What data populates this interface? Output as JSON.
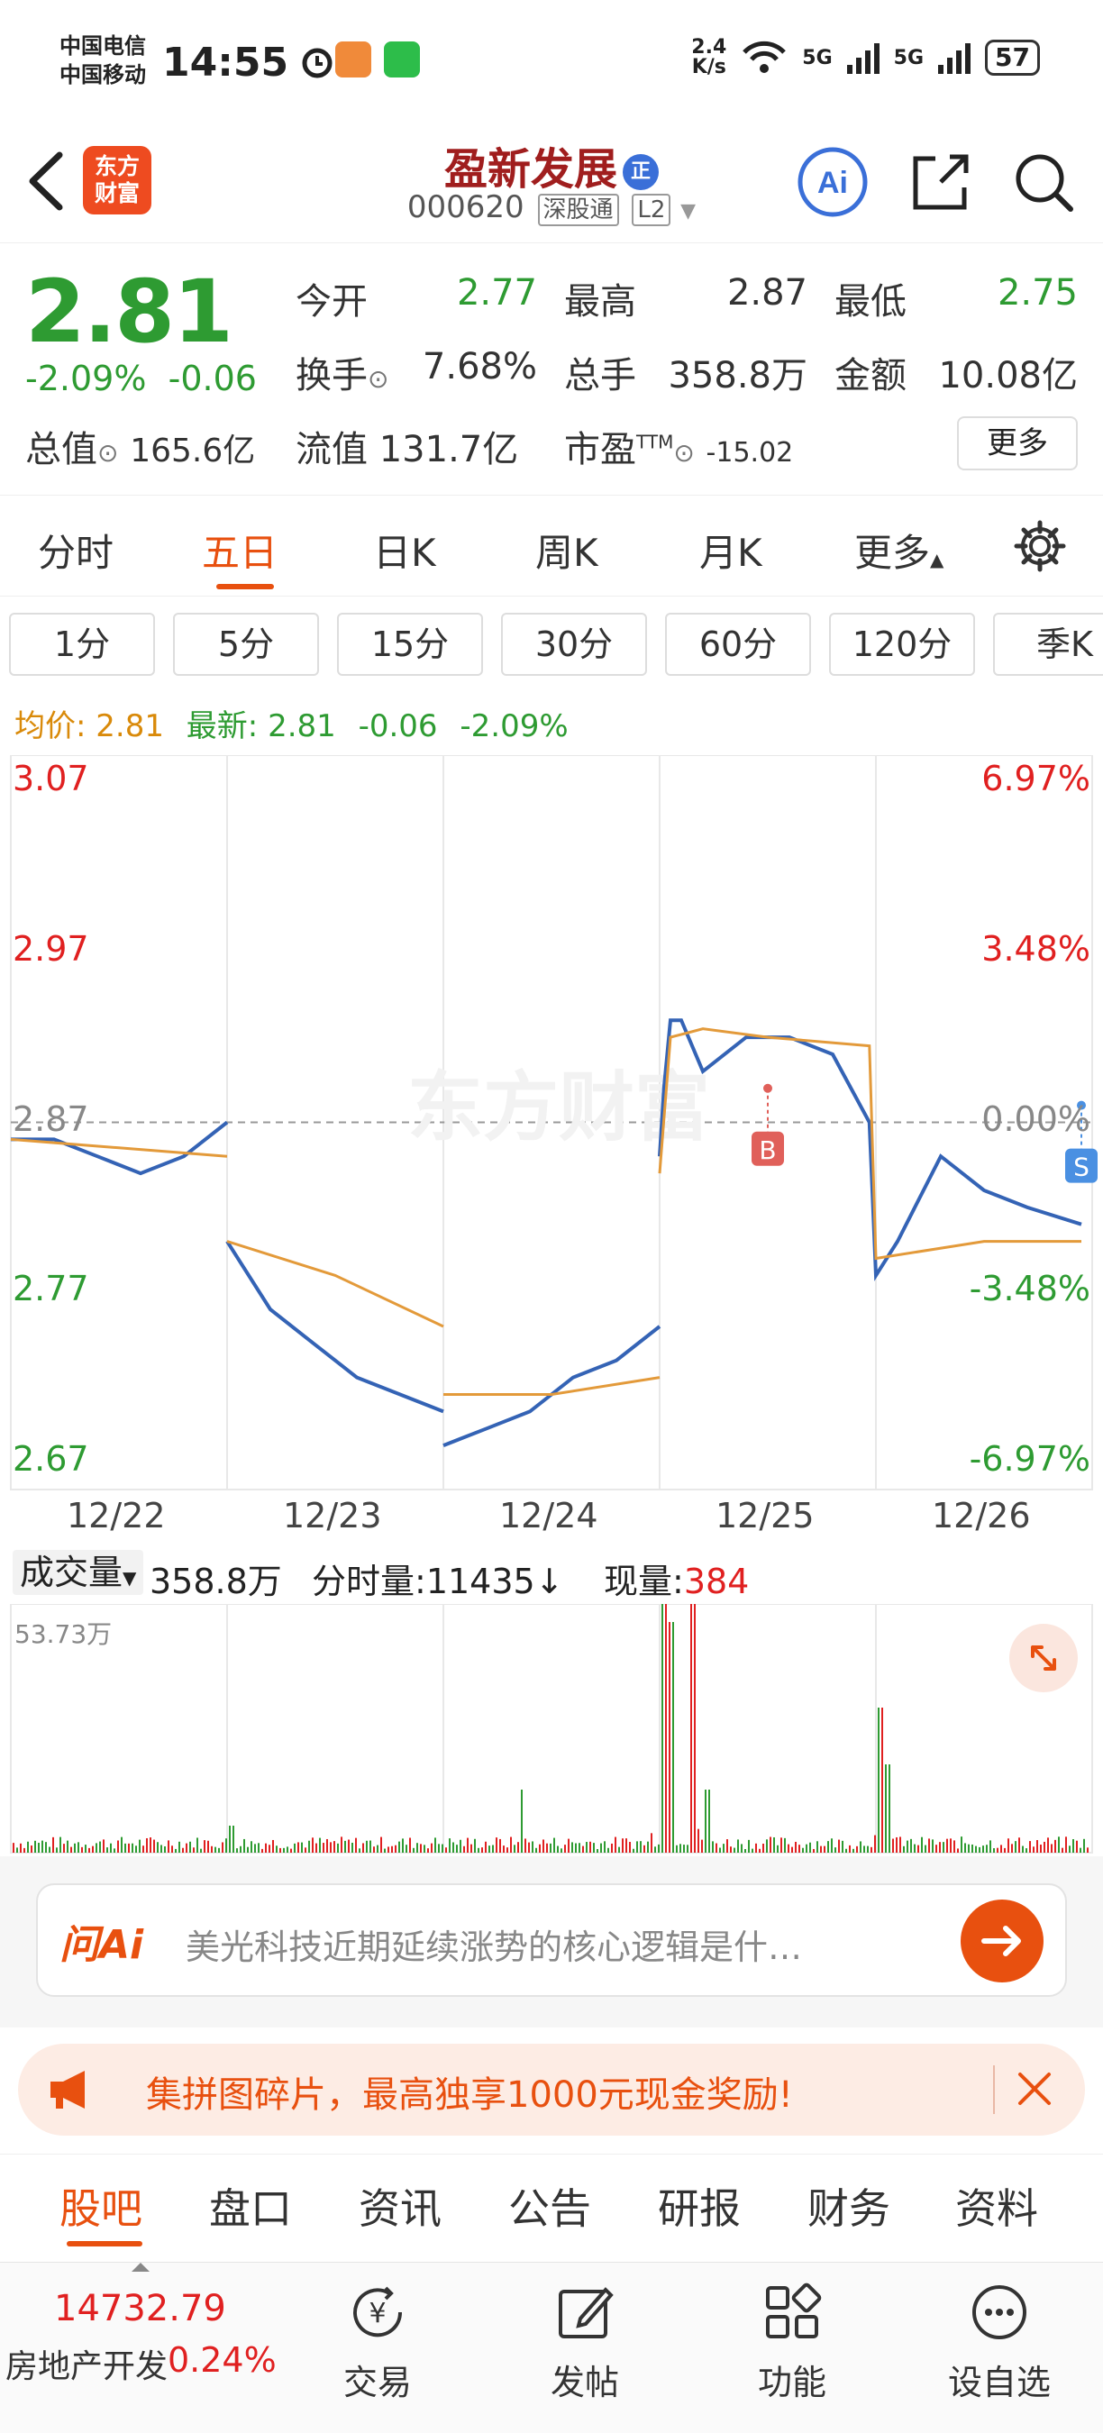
{
  "status_bar": {
    "carrier1": "中国电信",
    "carrier2": "中国移动",
    "time": "14:55",
    "net_speed_top": "2.4",
    "net_speed_bottom": "K/s",
    "signal1": "5G",
    "signal2": "5G",
    "battery": "57"
  },
  "header": {
    "logo_line1": "东方",
    "logo_line2": "财富",
    "stock_name": "盈新发展",
    "badge": "正",
    "stock_code": "000620",
    "tag1": "深股通",
    "tag2": "L2",
    "ai_label": "Ai"
  },
  "quote": {
    "price": "2.81",
    "change_pct": "-2.09%",
    "change": "-0.06",
    "open_label": "今开",
    "open": "2.77",
    "high_label": "最高",
    "high": "2.87",
    "low_label": "最低",
    "low": "2.75",
    "turnover_label": "换手",
    "turnover": "7.68%",
    "volume_label": "总手",
    "volume": "358.8万",
    "amount_label": "金额",
    "amount": "10.08亿",
    "mktcap_label": "总值",
    "mktcap": "165.6亿",
    "float_label": "流值",
    "float": "131.7亿",
    "pe_label": "市盈",
    "pe_sup": "TTM",
    "pe": "-15.02",
    "more_label": "更多"
  },
  "period_tabs": [
    "分时",
    "五日",
    "日K",
    "周K",
    "月K",
    "更多"
  ],
  "minute_buttons": [
    "1分",
    "5分",
    "15分",
    "30分",
    "60分",
    "120分",
    "季K"
  ],
  "legend": {
    "avg_label": "均价:",
    "avg": "2.81",
    "last_label": "最新:",
    "last": "2.81",
    "chg": "-0.06",
    "pct": "-2.09%"
  },
  "chart_data": {
    "type": "line",
    "title": "",
    "x_ticks": [
      "12/22",
      "12/23",
      "12/24",
      "12/25",
      "12/26"
    ],
    "y_ticks": [
      "3.07",
      "2.97",
      "2.87",
      "2.77",
      "2.67"
    ],
    "y_pct_ticks": [
      "6.97%",
      "3.48%",
      "0.00%",
      "-3.48%",
      "-6.97%"
    ],
    "ylim": [
      2.67,
      3.07
    ],
    "baseline": 2.87,
    "watermark": "东方财富",
    "series": [
      {
        "name": "最新",
        "color": "#3463b5",
        "x": [
          0,
          0.2,
          0.4,
          0.6,
          0.8,
          1.0,
          1.0,
          1.2,
          1.4,
          1.6,
          1.8,
          2.0,
          2.0,
          2.2,
          2.4,
          2.6,
          2.8,
          3.0,
          3.0,
          3.02,
          3.05,
          3.1,
          3.2,
          3.4,
          3.6,
          3.8,
          3.97,
          4.0,
          4.1,
          4.3,
          4.5,
          4.7,
          4.95
        ],
        "y": [
          2.86,
          2.86,
          2.85,
          2.84,
          2.85,
          2.87,
          2.8,
          2.76,
          2.74,
          2.72,
          2.71,
          2.7,
          2.68,
          2.69,
          2.7,
          2.72,
          2.73,
          2.75,
          2.85,
          2.89,
          2.93,
          2.93,
          2.9,
          2.92,
          2.92,
          2.91,
          2.87,
          2.78,
          2.8,
          2.85,
          2.83,
          2.82,
          2.81
        ]
      },
      {
        "name": "均价",
        "color": "#e39a3a",
        "x": [
          0,
          0.5,
          1.0,
          1.0,
          1.5,
          2.0,
          2.0,
          2.5,
          3.0,
          3.0,
          3.05,
          3.2,
          3.5,
          3.97,
          4.0,
          4.5,
          4.95
        ],
        "y": [
          2.86,
          2.855,
          2.85,
          2.8,
          2.78,
          2.75,
          2.71,
          2.71,
          2.72,
          2.84,
          2.92,
          2.925,
          2.92,
          2.915,
          2.79,
          2.8,
          2.8
        ]
      }
    ],
    "markers": [
      {
        "label": "B",
        "x": 3.5,
        "y": 2.89,
        "color": "#e0605a"
      },
      {
        "label": "S",
        "x": 4.95,
        "y": 2.88,
        "color": "#4a90e2"
      }
    ]
  },
  "volume": {
    "label": "成交量",
    "total": "358.8万",
    "intraday_label": "分时量:",
    "intraday": "11435",
    "intraday_arrow": "↓",
    "current_label": "现量:",
    "current": "384",
    "max_label": "53.73万"
  },
  "ai_bar": {
    "brand": "问Ai",
    "placeholder": "美光科技近期延续涨势的核心逻辑是什…"
  },
  "promo": {
    "text": "集拼图碎片，最高独享1000元现金奖励!"
  },
  "content_tabs": [
    "股吧",
    "盘口",
    "资讯",
    "公告",
    "研报",
    "财务",
    "资料"
  ],
  "bottom_nav": {
    "index_value": "14732.79",
    "index_name": "房地产开发",
    "index_pct": "0.24%",
    "items": [
      "交易",
      "发帖",
      "功能",
      "设自选"
    ]
  },
  "colors": {
    "accent": "#e8500f",
    "up": "#e02020",
    "down": "#2e9b32",
    "price_line": "#3463b5",
    "avg_line": "#e39a3a"
  }
}
